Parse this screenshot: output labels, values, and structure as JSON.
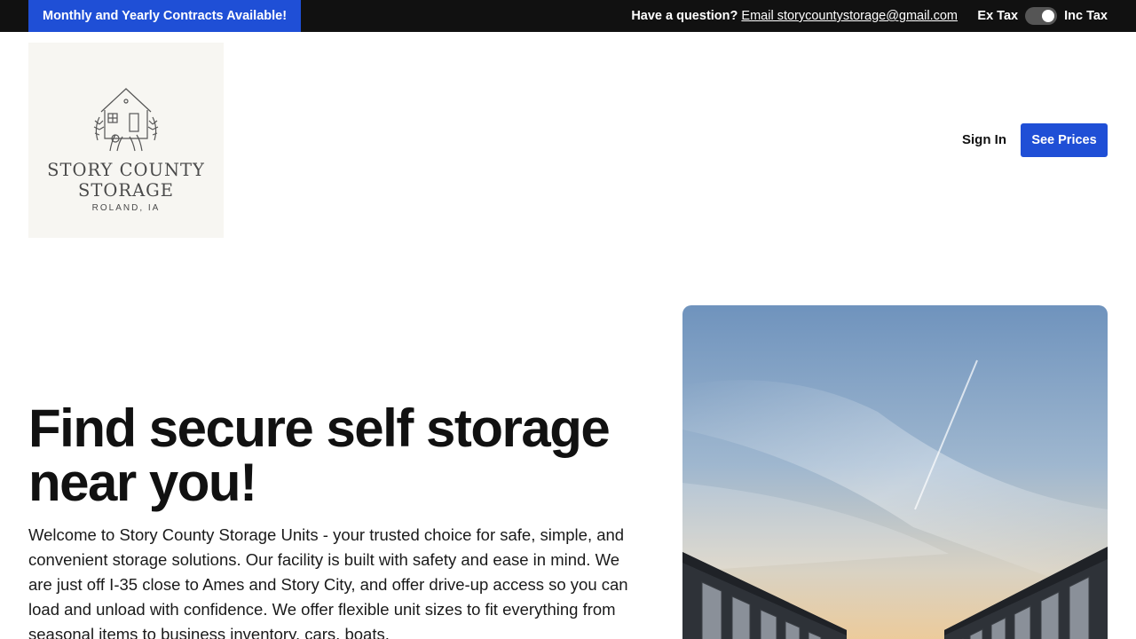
{
  "topbar": {
    "promo": "Monthly and Yearly Contracts Available!",
    "question": "Have a question?",
    "email_link": "Email storycountystorage@gmail.com",
    "ex_tax": "Ex Tax",
    "inc_tax": "Inc Tax"
  },
  "logo": {
    "name_line1": "STORY COUNTY",
    "name_line2": "STORAGE",
    "location": "ROLAND, IA"
  },
  "header": {
    "sign_in": "Sign In",
    "see_prices": "See Prices"
  },
  "hero": {
    "title": "Find secure self storage near you!",
    "body": "Welcome to Story County Storage Units - your trusted choice for safe, simple, and convenient storage solutions. Our facility is built with safety and ease in mind. We are just off I-35 close to Ames and Story City, and offer drive-up access so you can load and unload with confidence. We offer flexible unit sizes to fit everything from seasonal items to business inventory, cars, boats,"
  },
  "colors": {
    "accent": "#1f4fd6",
    "topbar_bg": "#111111"
  }
}
